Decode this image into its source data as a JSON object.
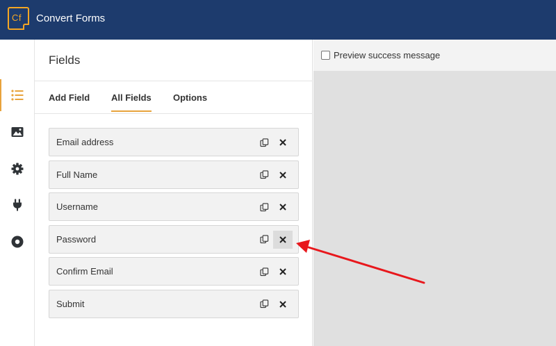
{
  "header": {
    "logo_text": "Cf",
    "app_name": "Convert Forms",
    "background": "#1d3b6d",
    "accent": "#f5a623"
  },
  "rail": {
    "items": [
      {
        "name": "fields",
        "icon": "list-icon",
        "active": true
      },
      {
        "name": "design",
        "icon": "image-icon",
        "active": false
      },
      {
        "name": "settings",
        "icon": "gear-icon",
        "active": false
      },
      {
        "name": "integrations",
        "icon": "plug-icon",
        "active": false
      },
      {
        "name": "submissions",
        "icon": "circle-icon",
        "active": false
      }
    ],
    "active_color": "#e8a33c"
  },
  "panel": {
    "title": "Fields",
    "tabs": [
      {
        "label": "Add Field",
        "active": false
      },
      {
        "label": "All Fields",
        "active": true
      },
      {
        "label": "Options",
        "active": false
      }
    ]
  },
  "fields": [
    {
      "label": "Email address"
    },
    {
      "label": "Full Name"
    },
    {
      "label": "Username"
    },
    {
      "label": "Password",
      "delete_hovered": true
    },
    {
      "label": "Confirm Email"
    },
    {
      "label": "Submit"
    }
  ],
  "preview": {
    "checkbox_label": "Preview success message",
    "checked": false
  },
  "annotation": {
    "arrow_color": "#e8171c",
    "points_to": "Password delete button"
  }
}
